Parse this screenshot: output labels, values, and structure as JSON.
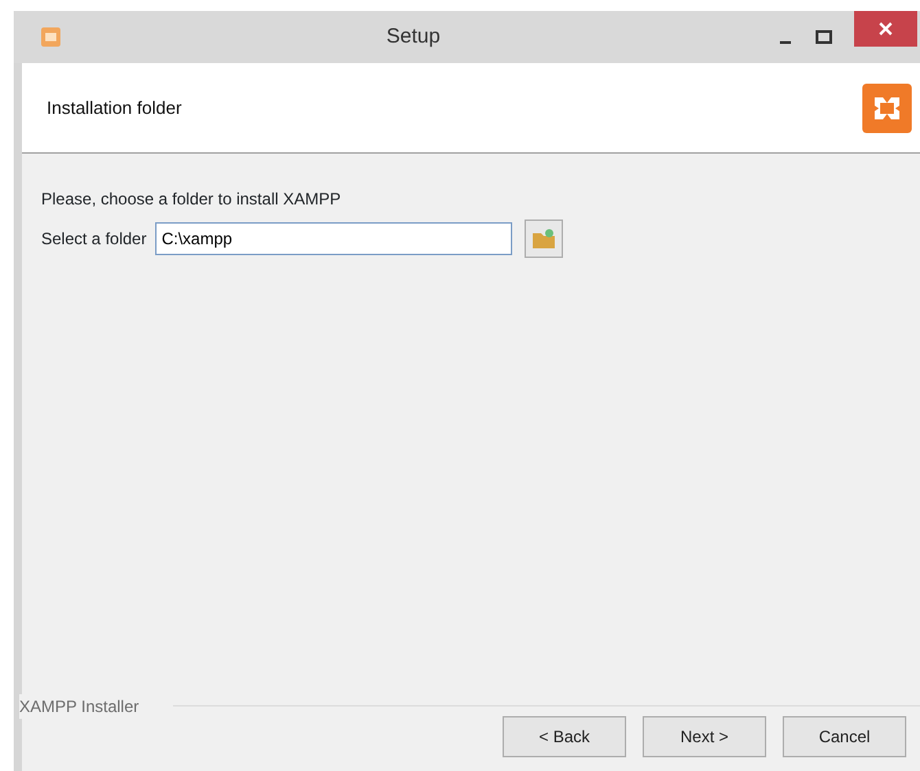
{
  "window": {
    "title": "Setup"
  },
  "header": {
    "title": "Installation folder"
  },
  "body": {
    "instruction": "Please, choose a folder to install XAMPP",
    "folder_label": "Select a folder",
    "folder_value": "C:\\xampp"
  },
  "footer": {
    "brand": "XAMPP Installer",
    "buttons": [
      "< Back",
      "Next >",
      "Cancel"
    ]
  }
}
